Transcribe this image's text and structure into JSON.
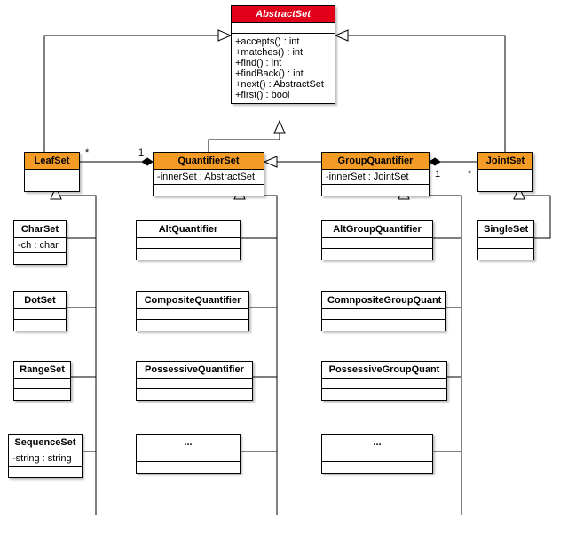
{
  "classes": {
    "AbstractSet": {
      "name": "AbstractSet",
      "methods": [
        "+accepts() : int",
        "+matches() : int",
        "+find() : int",
        "+findBack() : int",
        "+next() : AbstractSet",
        "+first() : bool"
      ]
    },
    "LeafSet": {
      "name": "LeafSet"
    },
    "QuantifierSet": {
      "name": "QuantifierSet",
      "attr": "-innerSet : AbstractSet"
    },
    "GroupQuantifier": {
      "name": "GroupQuantifier",
      "attr": "-innerSet : JointSet"
    },
    "JointSet": {
      "name": "JointSet"
    },
    "CharSet": {
      "name": "CharSet",
      "attr": "-ch : char"
    },
    "DotSet": {
      "name": "DotSet"
    },
    "RangeSet": {
      "name": "RangeSet"
    },
    "SequenceSet": {
      "name": "SequenceSet",
      "attr": "-string : string"
    },
    "AltQuantifier": {
      "name": "AltQuantifier"
    },
    "CompositeQuantifier": {
      "name": "CompositeQuantifier"
    },
    "PossessiveQuantifier": {
      "name": "PossessiveQuantifier"
    },
    "QuantEtc": {
      "name": "..."
    },
    "AltGroupQuantifier": {
      "name": "AltGroupQuantifier"
    },
    "ComnpositeGroupQuant": {
      "name": "ComnpositeGroupQuant"
    },
    "PossessiveGroupQuant": {
      "name": "PossessiveGroupQuant"
    },
    "GroupEtc": {
      "name": "..."
    },
    "SingleSet": {
      "name": "SingleSet"
    }
  },
  "multiplicities": {
    "leaf_star": "*",
    "leaf_one": "1",
    "joint_one": "1",
    "joint_star": "*"
  }
}
